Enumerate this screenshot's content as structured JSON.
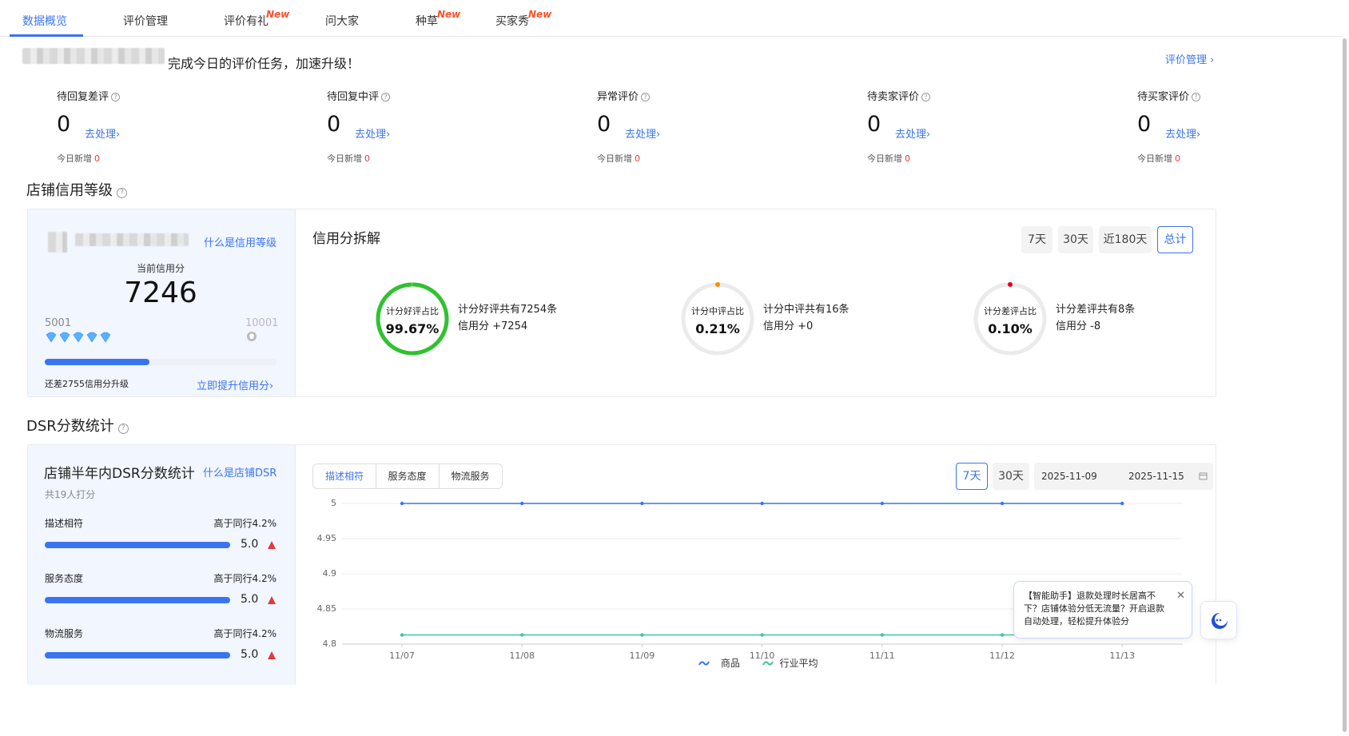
{
  "tabs": [
    {
      "label": "数据概览",
      "active": true
    },
    {
      "label": "评价管理"
    },
    {
      "label": "评价有礼",
      "badge": "New"
    },
    {
      "label": "问大家"
    },
    {
      "label": "种草",
      "badge": "New"
    },
    {
      "label": "买家秀",
      "badge": "New"
    }
  ],
  "task": {
    "message": "完成今日的评价任务，加速升级！",
    "manage_link": "评价管理 ›"
  },
  "pending": [
    {
      "title": "待回复差评",
      "count": "0",
      "action": "去处理›",
      "today_label": "今日新增",
      "today_value": "0"
    },
    {
      "title": "待回复中评",
      "count": "0",
      "action": "去处理›",
      "today_label": "今日新增",
      "today_value": "0"
    },
    {
      "title": "异常评价",
      "count": "0",
      "action": "去处理›",
      "today_label": "今日新增",
      "today_value": "0"
    },
    {
      "title": "待卖家评价",
      "count": "0",
      "action": "去处理›",
      "today_label": "今日新增",
      "today_value": "0"
    },
    {
      "title": "待买家评价",
      "count": "0",
      "action": "去处理›",
      "today_label": "今日新增",
      "today_value": "0"
    }
  ],
  "credit": {
    "section_title": "店铺信用等级",
    "what_link": "什么是信用等级",
    "current_label": "当前信用分",
    "score": "7246",
    "range_min": "5001",
    "range_max": "10001",
    "progress": 0.45,
    "gap_text": "还差2755信用分升级",
    "boost_link": "立即提升信用分›",
    "breakdown_title": "信用分拆解",
    "periods": [
      "7天",
      "30天",
      "近180天",
      "总计"
    ],
    "active_period": "总计",
    "rings": [
      {
        "label": "计分好评占比",
        "value": "99.67%",
        "desc1": "计分好评共有7254条",
        "desc2": "信用分 +7254",
        "ratio": 0.9967,
        "color": "#2fc22f",
        "dot": null
      },
      {
        "label": "计分中评占比",
        "value": "0.21%",
        "desc1": "计分中评共有16条",
        "desc2": "信用分 +0",
        "ratio": 0.0021,
        "color": "#ffffff",
        "dot": "#ff8a00"
      },
      {
        "label": "计分差评占比",
        "value": "0.10%",
        "desc1": "计分差评共有8条",
        "desc2": "信用分 -8",
        "ratio": 0.001,
        "color": "#ffffff",
        "dot": "#e60012"
      }
    ]
  },
  "dsr": {
    "section_title": "DSR分数统计",
    "panel_title": "店铺半年内DSR分数统计",
    "what_link": "什么是店铺DSR",
    "raters": "共19人打分",
    "items": [
      {
        "name": "描述相符",
        "compare": "高于同行4.2%",
        "score": "5.0",
        "ratio": 1.0
      },
      {
        "name": "服务态度",
        "compare": "高于同行4.2%",
        "score": "5.0",
        "ratio": 1.0
      },
      {
        "name": "物流服务",
        "compare": "高于同行4.2%",
        "score": "5.0",
        "ratio": 1.0
      }
    ],
    "segments": [
      "描述相符",
      "服务态度",
      "物流服务"
    ],
    "active_segment": "描述相符",
    "ranges": [
      "7天",
      "30天"
    ],
    "active_range": "7天",
    "date_start": "2025-11-09",
    "date_end": "2025-11-15"
  },
  "chart_data": {
    "type": "line",
    "x": [
      "11/07",
      "11/08",
      "11/09",
      "11/10",
      "11/11",
      "11/12",
      "11/13"
    ],
    "ylim": [
      4.8,
      5.0
    ],
    "yticks": [
      "5",
      "4.95",
      "4.9",
      "4.85",
      "4.8"
    ],
    "grid": true,
    "legend_placement": "bottom",
    "series": [
      {
        "name": "商品",
        "color": "#3b74f0",
        "values": [
          5.0,
          5.0,
          5.0,
          5.0,
          5.0,
          5.0,
          5.0
        ]
      },
      {
        "name": "行业平均",
        "color": "#3cc79a",
        "values": [
          4.813,
          4.813,
          4.813,
          4.813,
          4.813,
          4.813,
          4.813
        ]
      }
    ]
  },
  "assistant": {
    "message": "【智能助手】退款处理时长居高不下？店铺体验分低无流量？开启退款自动处理，轻松提升体验分",
    "close": "✕"
  }
}
